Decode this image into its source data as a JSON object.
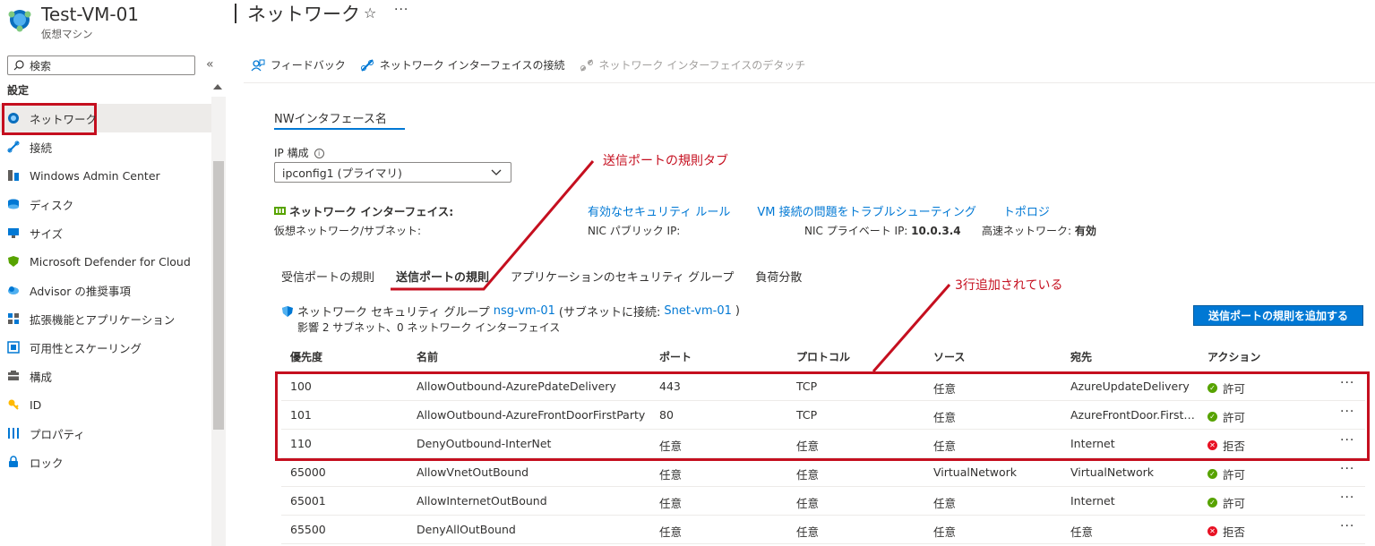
{
  "header": {
    "vm_name": "Test-VM-01",
    "vm_type": "仮想マシン",
    "page_title": "ネットワーク",
    "more": "···"
  },
  "sidebar": {
    "search_placeholder": "検索",
    "section_label": "設定",
    "items": [
      {
        "label": "ネットワーク",
        "icon": "network-icon",
        "selected": true
      },
      {
        "label": "接続",
        "icon": "connect-icon"
      },
      {
        "label": "Windows Admin Center",
        "icon": "admin-center-icon"
      },
      {
        "label": "ディスク",
        "icon": "disk-icon"
      },
      {
        "label": "サイズ",
        "icon": "size-icon"
      },
      {
        "label": "Microsoft Defender for Cloud",
        "icon": "defender-icon"
      },
      {
        "label": "Advisor の推奨事項",
        "icon": "advisor-icon"
      },
      {
        "label": "拡張機能とアプリケーション",
        "icon": "extensions-icon"
      },
      {
        "label": "可用性とスケーリング",
        "icon": "availability-icon"
      },
      {
        "label": "構成",
        "icon": "configuration-icon"
      },
      {
        "label": "ID",
        "icon": "identity-icon"
      },
      {
        "label": "プロパティ",
        "icon": "properties-icon"
      },
      {
        "label": "ロック",
        "icon": "lock-icon"
      }
    ]
  },
  "toolbar": {
    "feedback": "フィードバック",
    "attach": "ネットワーク インターフェイスの接続",
    "detach": "ネットワーク インターフェイスのデタッチ"
  },
  "nic": {
    "tab_label": "NWインタフェース名",
    "ip_config_label": "IP 構成",
    "ip_config_value": "ipconfig1 (プライマリ)",
    "section_title": "ネットワーク インターフェイス:",
    "vnet_subnet_label": "仮想ネットワーク/サブネット:",
    "links": [
      "有効なセキュリティ ルール",
      "VM 接続の問題をトラブルシューティング",
      "トポロジ"
    ],
    "public_ip_label": "NIC パブリック IP:",
    "private_ip_label": "NIC プライベート IP:",
    "private_ip_value": "10.0.3.4",
    "accel_label": "高速ネットワーク:",
    "accel_value": "有効"
  },
  "rule_tabs": [
    "受信ポートの規則",
    "送信ポートの規則",
    "アプリケーションのセキュリティ グループ",
    "負荷分散"
  ],
  "nsg": {
    "prefix": "ネットワーク セキュリティ グループ",
    "name": "nsg-vm-01",
    "mid": "(サブネットに接続:",
    "subnet": "Snet-vm-01",
    "suffix": ")",
    "impact": "影響 2 サブネット、0 ネットワーク インターフェイス",
    "add_button": "送信ポートの規則を追加する"
  },
  "table": {
    "headers": [
      "優先度",
      "名前",
      "ポート",
      "プロトコル",
      "ソース",
      "宛先",
      "アクション"
    ],
    "rows": [
      {
        "priority": "100",
        "name": "AllowOutbound-AzurePdateDelivery",
        "port": "443",
        "protocol": "TCP",
        "source": "任意",
        "dest": "AzureUpdateDelivery",
        "action": "許可",
        "status": "allow"
      },
      {
        "priority": "101",
        "name": "AllowOutbound-AzureFrontDoorFirstParty",
        "port": "80",
        "protocol": "TCP",
        "source": "任意",
        "dest": "AzureFrontDoor.FirstParty",
        "action": "許可",
        "status": "allow"
      },
      {
        "priority": "110",
        "name": "DenyOutbound-InterNet",
        "port": "任意",
        "protocol": "任意",
        "source": "任意",
        "dest": "Internet",
        "action": "拒否",
        "status": "deny"
      },
      {
        "priority": "65000",
        "name": "AllowVnetOutBound",
        "port": "任意",
        "protocol": "任意",
        "source": "VirtualNetwork",
        "dest": "VirtualNetwork",
        "action": "許可",
        "status": "allow"
      },
      {
        "priority": "65001",
        "name": "AllowInternetOutBound",
        "port": "任意",
        "protocol": "任意",
        "source": "任意",
        "dest": "Internet",
        "action": "許可",
        "status": "allow"
      },
      {
        "priority": "65500",
        "name": "DenyAllOutBound",
        "port": "任意",
        "protocol": "任意",
        "source": "任意",
        "dest": "任意",
        "action": "拒否",
        "status": "deny"
      }
    ],
    "row_more": "···"
  },
  "annotations": {
    "tab_note": "送信ポートの規則タブ",
    "rows_note": "3行追加されている"
  },
  "colors": {
    "accent": "#0078d4",
    "highlight": "#c50f1f",
    "allow": "#57a300",
    "deny": "#e81123"
  }
}
